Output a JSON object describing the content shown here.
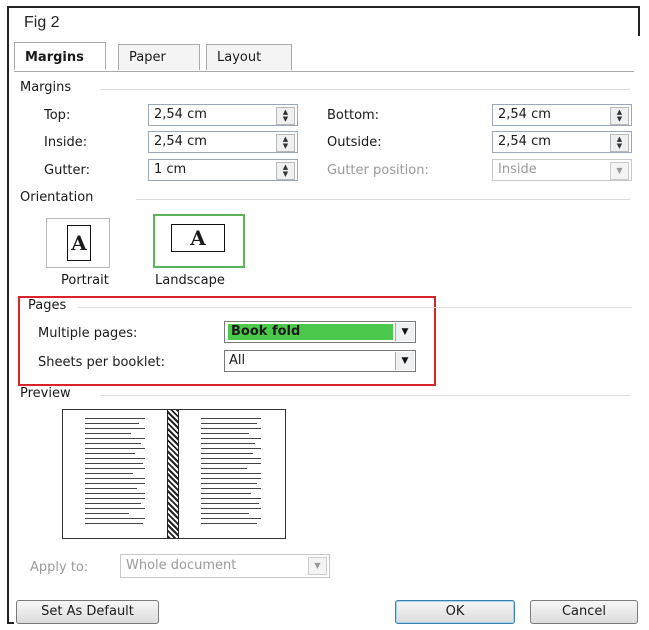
{
  "figure_label": "Fig 2",
  "tabs": [
    {
      "label": "Margins",
      "active": true
    },
    {
      "label": "Paper",
      "active": false
    },
    {
      "label": "Layout",
      "active": false
    }
  ],
  "margins": {
    "section_title": "Margins",
    "top": {
      "label": "Top:",
      "value": "2,54 cm"
    },
    "bottom": {
      "label": "Bottom:",
      "value": "2,54 cm"
    },
    "inside": {
      "label": "Inside:",
      "value": "2,54 cm"
    },
    "outside": {
      "label": "Outside:",
      "value": "2,54 cm"
    },
    "gutter": {
      "label": "Gutter:",
      "value": "1 cm"
    },
    "gutter_position": {
      "label": "Gutter position:",
      "value": "Inside",
      "disabled": true
    }
  },
  "orientation": {
    "section_title": "Orientation",
    "portrait_label": "Portrait",
    "landscape_label": "Landscape",
    "selected": "Landscape",
    "glyph": "A"
  },
  "pages": {
    "section_title": "Pages",
    "multiple_pages": {
      "label": "Multiple pages:",
      "value": "Book fold",
      "highlight_color": "#4cc94c"
    },
    "sheets_per_booklet": {
      "label": "Sheets per booklet:",
      "value": "All"
    },
    "annotation_color": "#d8232a"
  },
  "preview": {
    "section_title": "Preview"
  },
  "apply_to": {
    "label": "Apply to:",
    "value": "Whole document",
    "disabled": true
  },
  "buttons": {
    "set_default": "Set As Default",
    "ok": "OK",
    "cancel": "Cancel"
  }
}
